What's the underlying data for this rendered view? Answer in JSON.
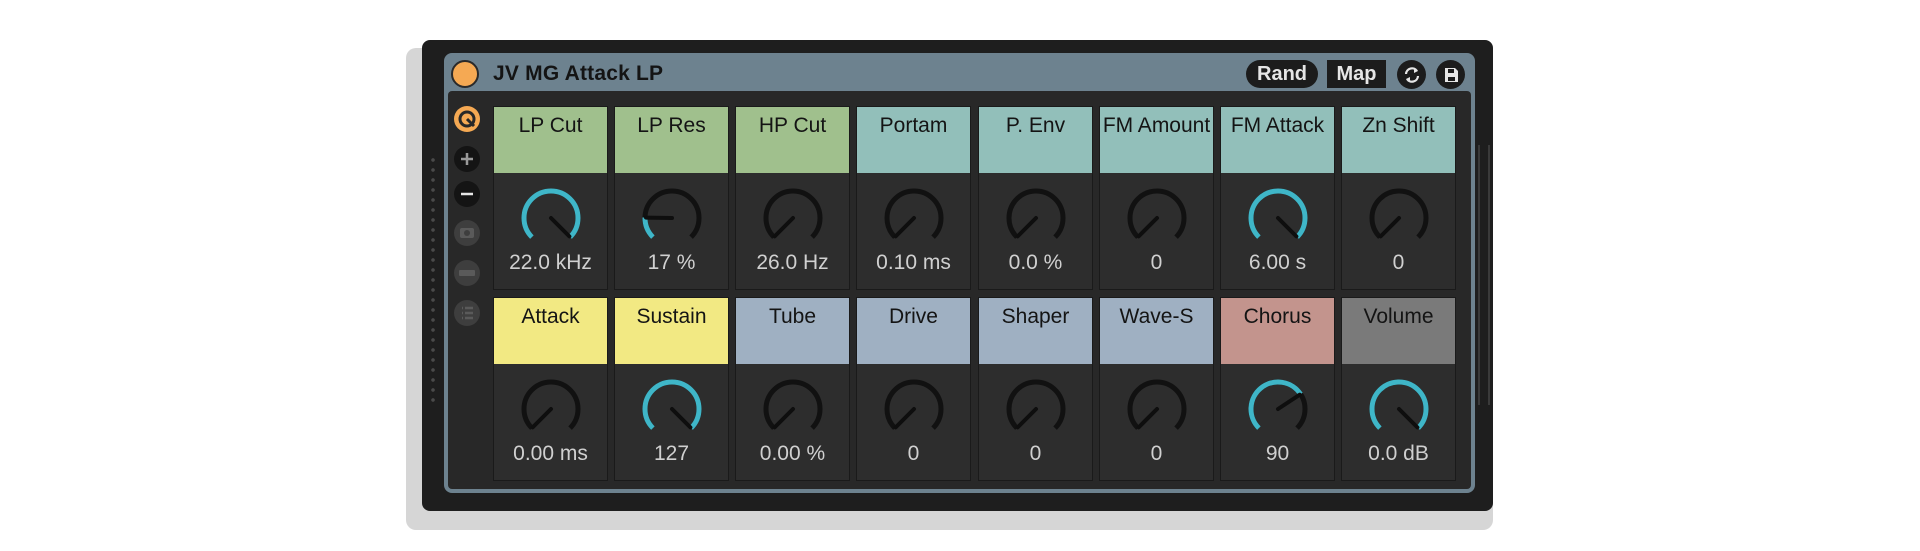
{
  "device": {
    "title": "JV MG Attack LP",
    "rand_label": "Rand",
    "map_label": "Map"
  },
  "colors": {
    "green": "#a0c08d",
    "teal": "#92bfba",
    "yellow": "#f2e983",
    "blue": "#9fb0c2",
    "red": "#c3948d",
    "gray": "#7a7a7a",
    "knob_active": "#3fb6c8",
    "knob_track": "#111111"
  },
  "macros": [
    {
      "name": "LP Cut",
      "value": "22.0 kHz",
      "color": "#a0c08d",
      "level": 1.0
    },
    {
      "name": "LP Res",
      "value": "17 %",
      "color": "#a0c08d",
      "level": 0.17
    },
    {
      "name": "HP Cut",
      "value": "26.0 Hz",
      "color": "#a0c08d",
      "level": 0.0
    },
    {
      "name": "Portam",
      "value": "0.10 ms",
      "color": "#92bfba",
      "level": 0.0
    },
    {
      "name": "P. Env",
      "value": "0.0 %",
      "color": "#92bfba",
      "level": 0.0
    },
    {
      "name": "FM Amount",
      "value": "0",
      "color": "#92bfba",
      "level": 0.0
    },
    {
      "name": "FM Attack",
      "value": "6.00 s",
      "color": "#92bfba",
      "level": 1.0
    },
    {
      "name": "Zn Shift",
      "value": "0",
      "color": "#92bfba",
      "level": 0.0
    },
    {
      "name": "Attack",
      "value": "0.00 ms",
      "color": "#f2e983",
      "level": 0.0
    },
    {
      "name": "Sustain",
      "value": "127",
      "color": "#f2e983",
      "level": 1.0
    },
    {
      "name": "Tube",
      "value": "0.00 %",
      "color": "#9fb0c2",
      "level": 0.0
    },
    {
      "name": "Drive",
      "value": "0",
      "color": "#9fb0c2",
      "level": 0.0
    },
    {
      "name": "Shaper",
      "value": "0",
      "color": "#9fb0c2",
      "level": 0.0
    },
    {
      "name": "Wave-S",
      "value": "0",
      "color": "#9fb0c2",
      "level": 0.0
    },
    {
      "name": "Chorus",
      "value": "90",
      "color": "#c3948d",
      "level": 0.71
    },
    {
      "name": "Volume",
      "value": "0.0 dB",
      "color": "#7a7a7a",
      "level": 1.0
    }
  ],
  "side_icons": [
    "hot-swap-icon",
    "add-macro-icon",
    "remove-macro-icon",
    "snapshot-icon",
    "macro-variations-icon",
    "list-icon"
  ],
  "header_icons": [
    "sync-icon",
    "save-icon"
  ]
}
